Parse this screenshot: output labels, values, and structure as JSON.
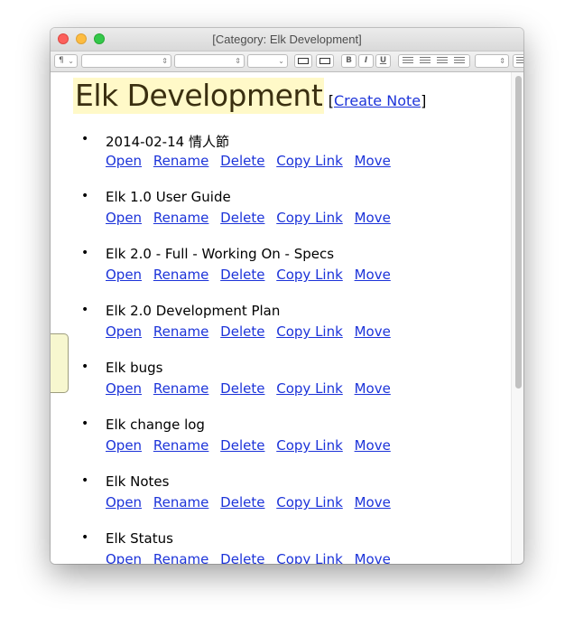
{
  "window": {
    "title": "[Category: Elk Development]"
  },
  "toolbar": {
    "paragraph_label": "¶",
    "bold_label": "B",
    "italic_label": "I",
    "underline_label": "U"
  },
  "page": {
    "title": "Elk Development",
    "create_note_open": "[",
    "create_note_label": "Create Note",
    "create_note_close": "]"
  },
  "notes": [
    {
      "name": "2014-02-14 情人節"
    },
    {
      "name": "Elk 1.0 User Guide"
    },
    {
      "name": "Elk 2.0 - Full - Working On - Specs"
    },
    {
      "name": "Elk 2.0 Development Plan"
    },
    {
      "name": "Elk bugs"
    },
    {
      "name": "Elk change log"
    },
    {
      "name": "Elk Notes"
    },
    {
      "name": "Elk Status"
    }
  ],
  "actions": {
    "open": "Open",
    "rename": "Rename",
    "delete": "Delete",
    "copy_link": "Copy Link",
    "move": "Move"
  },
  "bullet": "•",
  "colors": {
    "link": "#1c33d9",
    "title_highlight": "#fff9c8",
    "side_tab": "#f7f7cf"
  }
}
